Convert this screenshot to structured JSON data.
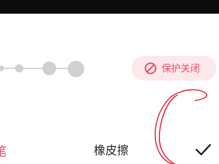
{
  "protection": {
    "label": "保护关闭",
    "icon": "prohibited-icon",
    "color": "#ef4a6a",
    "background": "#fde8ec"
  },
  "brush_size": {
    "levels": 4,
    "selected_level": null
  },
  "toolbar": {
    "left_tool_label": "笔",
    "eraser_label": "橡皮擦",
    "confirm_icon": "checkmark-icon",
    "active_color": "#ef3e5a"
  },
  "annotation": {
    "color": "#e8243c",
    "shape": "red-circle-scribble"
  }
}
